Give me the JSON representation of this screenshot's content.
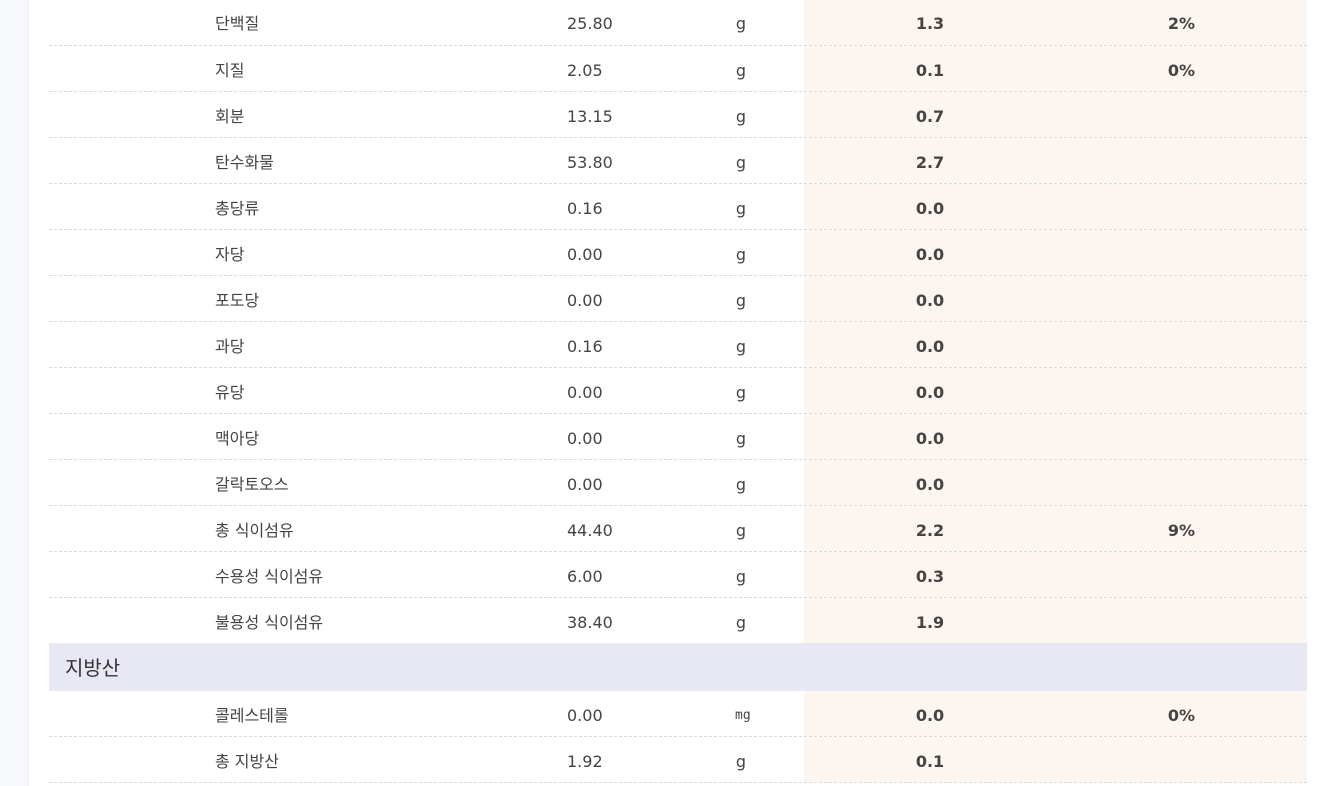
{
  "rows_top": [
    {
      "name": "단백질",
      "amount": "25.80",
      "unit": "g",
      "per_serving": "1.3",
      "daily_pct": "2%"
    },
    {
      "name": "지질",
      "amount": "2.05",
      "unit": "g",
      "per_serving": "0.1",
      "daily_pct": "0%"
    },
    {
      "name": "회분",
      "amount": "13.15",
      "unit": "g",
      "per_serving": "0.7",
      "daily_pct": ""
    },
    {
      "name": "탄수화물",
      "amount": "53.80",
      "unit": "g",
      "per_serving": "2.7",
      "daily_pct": ""
    },
    {
      "name": "총당류",
      "amount": "0.16",
      "unit": "g",
      "per_serving": "0.0",
      "daily_pct": ""
    },
    {
      "name": "자당",
      "amount": "0.00",
      "unit": "g",
      "per_serving": "0.0",
      "daily_pct": ""
    },
    {
      "name": "포도당",
      "amount": "0.00",
      "unit": "g",
      "per_serving": "0.0",
      "daily_pct": ""
    },
    {
      "name": "과당",
      "amount": "0.16",
      "unit": "g",
      "per_serving": "0.0",
      "daily_pct": ""
    },
    {
      "name": "유당",
      "amount": "0.00",
      "unit": "g",
      "per_serving": "0.0",
      "daily_pct": ""
    },
    {
      "name": "맥아당",
      "amount": "0.00",
      "unit": "g",
      "per_serving": "0.0",
      "daily_pct": ""
    },
    {
      "name": "갈락토오스",
      "amount": "0.00",
      "unit": "g",
      "per_serving": "0.0",
      "daily_pct": ""
    },
    {
      "name": "총 식이섬유",
      "amount": "44.40",
      "unit": "g",
      "per_serving": "2.2",
      "daily_pct": "9%"
    },
    {
      "name": "수용성 식이섬유",
      "amount": "6.00",
      "unit": "g",
      "per_serving": "0.3",
      "daily_pct": ""
    },
    {
      "name": "불용성 식이섬유",
      "amount": "38.40",
      "unit": "g",
      "per_serving": "1.9",
      "daily_pct": ""
    }
  ],
  "section": {
    "title": "지방산"
  },
  "rows_bottom": [
    {
      "name": "콜레스테롤",
      "amount": "0.00",
      "unit": "mg",
      "per_serving": "0.0",
      "daily_pct": "0%"
    },
    {
      "name": "총 지방산",
      "amount": "1.92",
      "unit": "g",
      "per_serving": "0.1",
      "daily_pct": ""
    }
  ]
}
